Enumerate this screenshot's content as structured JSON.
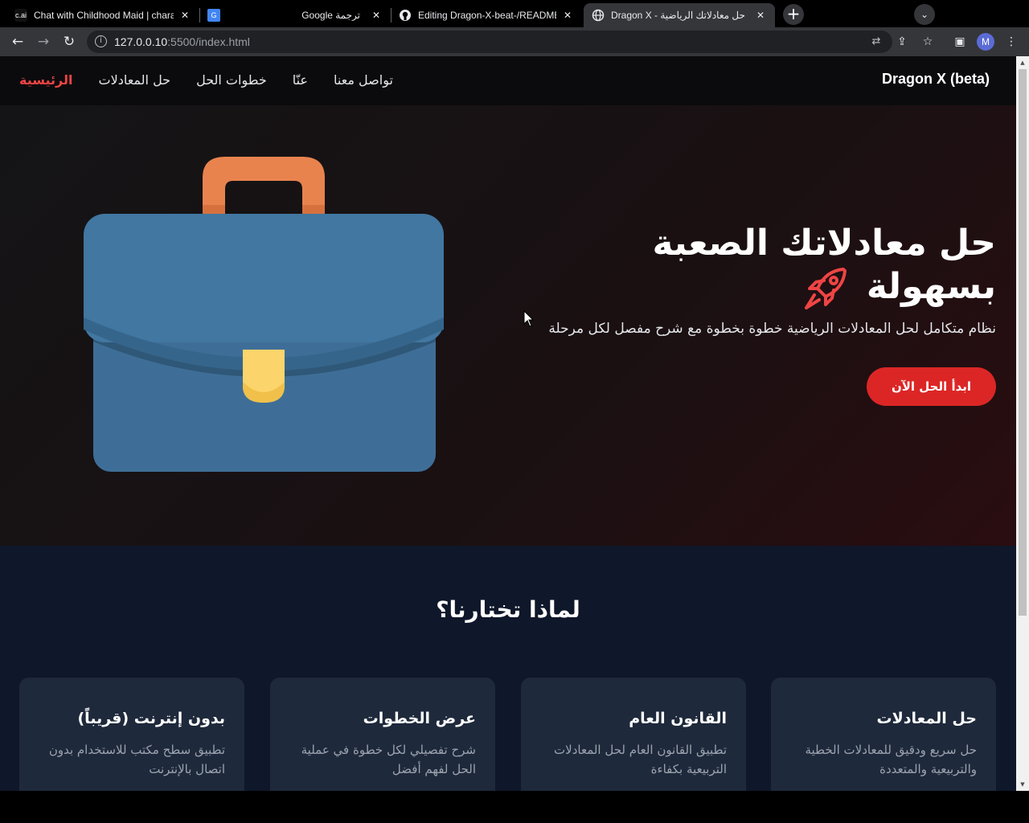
{
  "browser": {
    "tabs": [
      {
        "title": "Chat with Childhood Maid | chara",
        "favicon": "c.ai"
      },
      {
        "title": "Google ترجمة",
        "favicon": "G"
      },
      {
        "title": "Editing Dragon-X-beat-/README",
        "favicon": "github-icon"
      },
      {
        "title": "Dragon X - حل معادلاتك الرياضية",
        "favicon": "globe-icon"
      }
    ],
    "url_host": "127.0.0.10",
    "url_path": ":5500/index.html",
    "profile_initial": "M"
  },
  "site": {
    "brand": "Dragon X (beta)",
    "nav": [
      "الرئيسية",
      "حل المعادلات",
      "خطوات الحل",
      "عنّا",
      "تواصل معنا"
    ],
    "active_nav": "الرئيسية",
    "hero": {
      "title": "حل معادلاتك الصعبة بسهولة",
      "subtitle": "نظام متكامل لحل المعادلات الرياضية خطوة بخطوة مع شرح مفصل لكل مرحلة",
      "cta": "ابدأ الحل الآن"
    },
    "features_title": "لماذا تختارنا؟",
    "features": [
      {
        "title": "حل المعادلات",
        "text": "حل سريع ودقيق للمعادلات الخطية والتربيعية والمتعددة"
      },
      {
        "title": "القانون العام",
        "text": "تطبيق القانون العام لحل المعادلات التربيعية بكفاءة"
      },
      {
        "title": "عرض الخطوات",
        "text": "شرح تفصيلي لكل خطوة في عملية الحل لفهم أفضل"
      },
      {
        "title": "بدون إنترنت (قريباً)",
        "text": "تطبيق سطح مكتب للاستخدام بدون اتصال بالإنترنت"
      }
    ],
    "colors": {
      "accent": "#dc2626",
      "card_bg": "#1e293b",
      "page_bg": "#0f172a"
    }
  }
}
